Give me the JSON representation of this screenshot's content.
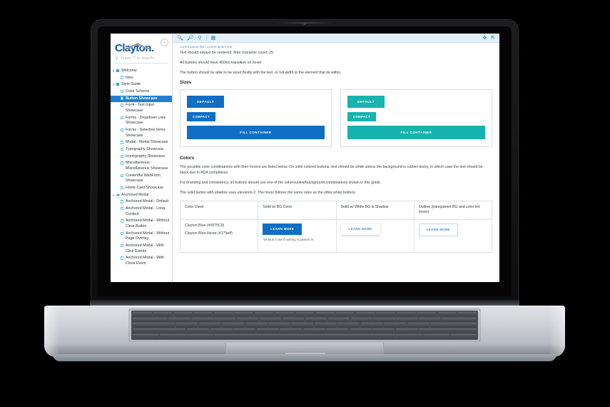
{
  "device": {
    "type": "laptop"
  },
  "sidebar": {
    "brand": {
      "name": "Clayton",
      "period": "."
    },
    "collapse_label": "–",
    "search": {
      "icon": "search-icon",
      "placeholder": "Press \"/\" to search..."
    },
    "tree": [
      {
        "level": 1,
        "icon": "folder-icon",
        "caret": "▾",
        "label": "Welcome",
        "selected": false
      },
      {
        "level": 2,
        "icon": "doc-icon",
        "caret": "",
        "label": "Intro",
        "selected": false
      },
      {
        "level": 1,
        "icon": "folder-icon",
        "caret": "▾",
        "label": "Style Guide",
        "selected": false
      },
      {
        "level": 2,
        "icon": "doc-icon",
        "caret": "",
        "label": "Color Scheme",
        "selected": false
      },
      {
        "level": 2,
        "icon": "doc-icon",
        "caret": "",
        "label": "Button Showcase",
        "selected": true
      },
      {
        "level": 2,
        "icon": "doc-icon",
        "caret": "",
        "label": "Form - Text Input Showcase",
        "selected": false
      },
      {
        "level": 2,
        "icon": "doc-icon",
        "caret": "",
        "label": "Forms - Dropdown Lists Showcase",
        "selected": false
      },
      {
        "level": 2,
        "icon": "doc-icon",
        "caret": "",
        "label": "Forms - Selection Items Showcase",
        "selected": false
      },
      {
        "level": 2,
        "icon": "doc-icon",
        "caret": "",
        "label": "Modal - Modal Showcase",
        "selected": false
      },
      {
        "level": 2,
        "icon": "doc-icon",
        "caret": "",
        "label": "Typography Showcase",
        "selected": false
      },
      {
        "level": 2,
        "icon": "doc-icon",
        "caret": "",
        "label": "Iconography Showcase",
        "selected": false
      },
      {
        "level": 2,
        "icon": "doc-icon",
        "caret": "",
        "label": "Miscellaneous - Miscellaneous Showcase",
        "selected": false
      },
      {
        "level": 2,
        "icon": "doc-icon",
        "caret": "",
        "label": "Contentful WebForm Showcase",
        "selected": false
      },
      {
        "level": 2,
        "icon": "doc-icon",
        "caret": "",
        "label": "Home Card Showcase",
        "selected": false
      },
      {
        "level": 1,
        "icon": "gear-icon",
        "caret": "▾",
        "label": "Anchored Modal",
        "selected": false
      },
      {
        "level": 2,
        "icon": "doc-icon",
        "caret": "",
        "label": "Anchored Modal - Default",
        "selected": false
      },
      {
        "level": 2,
        "icon": "doc-icon",
        "caret": "",
        "label": "Anchored Modal - Long Content",
        "selected": false
      },
      {
        "level": 2,
        "icon": "doc-icon",
        "caret": "",
        "label": "Anchored Modal - Without Clear Button",
        "selected": false
      },
      {
        "level": 2,
        "icon": "doc-icon",
        "caret": "",
        "label": "Anchored Modal - Without Page Overlay",
        "selected": false
      },
      {
        "level": 2,
        "icon": "doc-icon",
        "caret": "",
        "label": "Anchored Modal - With Click Events",
        "selected": false
      },
      {
        "level": 2,
        "icon": "doc-icon",
        "caret": "",
        "label": "Anchored Modal - With Close Event",
        "selected": false
      }
    ]
  },
  "toolbar": {
    "zoom_in": "zoom-in-icon",
    "zoom_out": "zoom-out-icon",
    "zoom_reset": "zoom-reset-icon",
    "grid": "grid-icon",
    "expand": "expand-icon",
    "open_new": "open-in-new-icon"
  },
  "main": {
    "breadcrumb": "Lorem ipsum link | Lorem ipsum link",
    "paragraphs": [
      "Text should always be centered. Max character count: 25.",
      "All buttons should have 450ms transition on hover.",
      "The button should be able to be sized fluidly with the text, or full width to the element that its within."
    ],
    "sizes": {
      "heading": "Sizes",
      "cards": [
        {
          "color": "blue",
          "buttons": [
            "DEFAULT",
            "COMPACT",
            "FILL CONTAINER"
          ]
        },
        {
          "color": "teal",
          "buttons": [
            "DEFAULT",
            "COMPACT",
            "FILL CONTAINER"
          ]
        }
      ]
    },
    "colors": {
      "heading": "Colors",
      "paragraphs": [
        "The possible color combinations with their hovers are listed below. On solid colored buttons, text should be white unless the background is rubber-ducky, in which case the text should be black due to ADA compliance.",
        "For branding and consistency, all buttons should use one of the color/outline/background combinations shown in this guide.",
        "The solid button with shadow uses elevation-2. The hover follows the same rules as the other white buttons."
      ],
      "table": {
        "headers": [
          "Color Used",
          "Solid w/ BG Color",
          "Solid w/ White BG & Shadow",
          "Outline (transparent BG and color tint hover)"
        ],
        "rows": [
          {
            "color_name": "Clayton Blue (#0075C9)",
            "hover_name": "Clayton Blue Hover (#179eff)",
            "solid_label": "LEARN MORE",
            "solid_note": "*Default Color if nothing is passed in",
            "shadow_label": "LEARN MORE",
            "outline_label": "LEARN MORE"
          }
        ]
      }
    }
  },
  "palette": {
    "clayton_blue": "#0075C9",
    "clayton_blue_hover": "#179eff",
    "teal": "#17B3AE",
    "toolbar_bg": "#E3F0FB",
    "selection_blue": "#1F7FD6"
  }
}
